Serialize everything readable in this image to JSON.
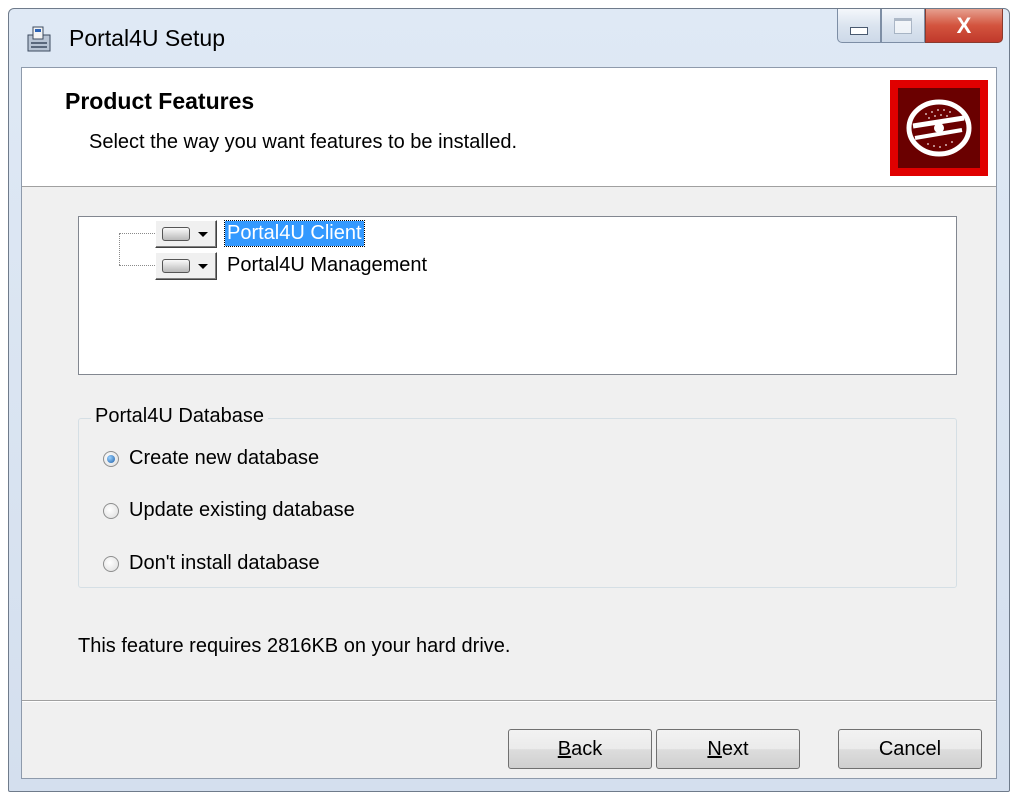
{
  "window": {
    "title": "Portal4U Setup",
    "close_glyph": "X"
  },
  "banner": {
    "title": "Product Features",
    "subtitle": "Select the way you want features to be installed.",
    "logo_icon": "disc-icon",
    "logo_color": "#e00000"
  },
  "features": {
    "items": [
      {
        "label": "Portal4U Client",
        "selected": true,
        "icon": "hard-drive-icon"
      },
      {
        "label": "Portal4U Management",
        "selected": false,
        "icon": "hard-drive-icon"
      }
    ]
  },
  "database": {
    "legend": "Portal4U Database",
    "options": [
      {
        "label": "Create new database",
        "checked": true
      },
      {
        "label": "Update existing database",
        "checked": false
      },
      {
        "label": "Don't install database",
        "checked": false
      }
    ]
  },
  "requirement_text": "This feature requires 2816KB on your hard drive.",
  "buttons": {
    "back": {
      "mnemonic": "B",
      "rest": "ack"
    },
    "next": {
      "mnemonic": "N",
      "rest": "ext"
    },
    "cancel": "Cancel"
  }
}
